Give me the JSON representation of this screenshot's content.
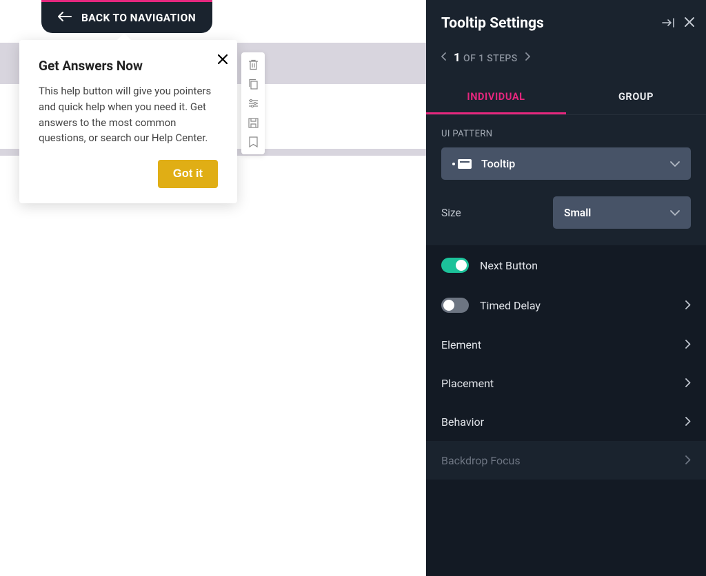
{
  "backNav": {
    "label": "BACK TO NAVIGATION"
  },
  "tooltip": {
    "title": "Get Answers Now",
    "body": "This help button will give you pointers and quick help when you need it. Get answers to the most common questions, or search our Help Center.",
    "button": "Got it"
  },
  "panel": {
    "title": "Tooltip Settings",
    "steps": {
      "current": "1",
      "rest": "OF 1 STEPS"
    },
    "tabs": {
      "individual": "INDIVIDUAL",
      "group": "GROUP"
    },
    "uiPatternLabel": "UI PATTERN",
    "uiPatternValue": "Tooltip",
    "sizeLabel": "Size",
    "sizeValue": "Small",
    "options": {
      "nextButton": "Next Button",
      "timedDelay": "Timed Delay",
      "element": "Element",
      "placement": "Placement",
      "behavior": "Behavior",
      "backdropFocus": "Backdrop Focus"
    }
  }
}
